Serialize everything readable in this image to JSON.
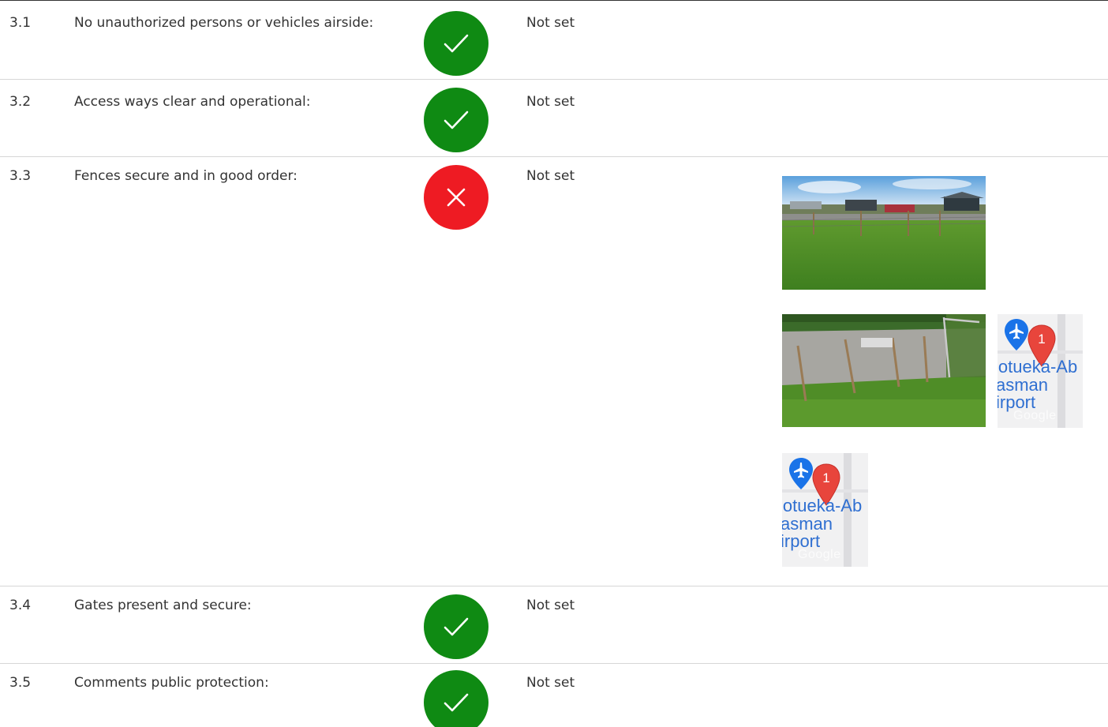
{
  "checklist": [
    {
      "number": "3.1",
      "label": "No unauthorized persons or vehicles airside:",
      "status": "pass",
      "value": "Not set"
    },
    {
      "number": "3.2",
      "label": "Access ways clear and operational:",
      "status": "pass",
      "value": "Not set"
    },
    {
      "number": "3.3",
      "label": "Fences secure and in good order:",
      "status": "fail",
      "value": "Not set",
      "attachments": {
        "map_label": "Motueka-Abel Tasman Airport",
        "map_label_lines": [
          "lotueka-Ab",
          "asman",
          "irport"
        ],
        "pin_number": "1",
        "map_watermark": "Google"
      }
    },
    {
      "number": "3.4",
      "label": "Gates present and secure:",
      "status": "pass",
      "value": "Not set"
    },
    {
      "number": "3.5",
      "label": "Comments public protection:",
      "status": "pass",
      "value": "Not set"
    }
  ],
  "colors": {
    "pass": "#0f8a13",
    "fail": "#ee1b23",
    "divider": "#d6d6d6",
    "text": "#333333",
    "map_label": "#2f6fd1",
    "pin": "#e8453c",
    "airport_marker": "#1a73e8"
  },
  "icons": {
    "pass": "check-icon",
    "fail": "close-icon",
    "map_pin": "map-pin-icon",
    "airport": "airplane-icon"
  }
}
